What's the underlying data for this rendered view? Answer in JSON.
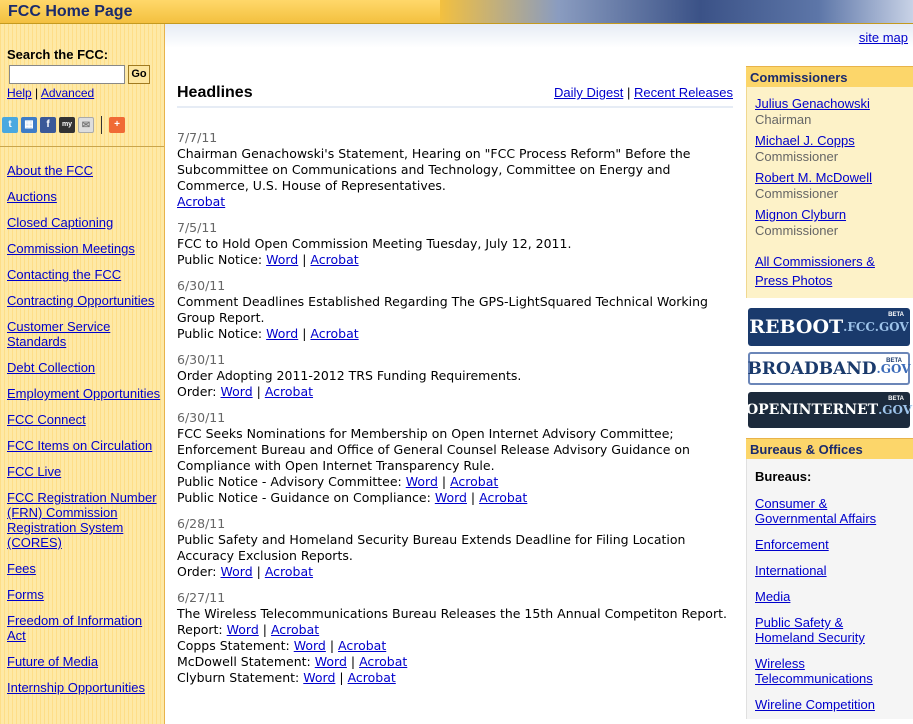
{
  "header": {
    "title": "FCC Home Page",
    "site_map": "site map"
  },
  "search": {
    "label": "Search the FCC:",
    "value": "",
    "go": "Go",
    "help": "Help",
    "advanced": "Advanced"
  },
  "share_icons": [
    "twitter-icon",
    "delicious-icon",
    "facebook-icon",
    "myspace-icon",
    "email-icon",
    "addthis-plus-icon"
  ],
  "left_nav": [
    "About the FCC",
    "Auctions",
    "Closed Captioning",
    "Commission Meetings",
    "Contacting the FCC",
    "Contracting Opportunities",
    "Customer Service Standards",
    "Debt Collection",
    "Employment Opportunities",
    "FCC Connect",
    "FCC Items on Circulation",
    "FCC Live",
    "FCC Registration Number (FRN) Commission Registration System (CORES)",
    "Fees",
    "Forms",
    "Freedom of Information Act",
    "Future of Media",
    "Internship Opportunities"
  ],
  "headlines": {
    "title": "Headlines",
    "daily_digest": "Daily Digest",
    "recent_releases": "Recent Releases",
    "items": [
      {
        "date": "7/7/11",
        "text": "Chairman Genachowski's Statement, Hearing on \"FCC Process Reform\" Before the Subcommittee on Communications and Technology, Committee on Energy and Commerce, U.S. House of Representatives.",
        "links": [
          {
            "label": "",
            "docs": [
              "Acrobat"
            ]
          }
        ]
      },
      {
        "date": "7/5/11",
        "text": "FCC to Hold Open Commission Meeting Tuesday, July 12, 2011.",
        "links": [
          {
            "label": "Public Notice:",
            "docs": [
              "Word",
              "Acrobat"
            ]
          }
        ]
      },
      {
        "date": "6/30/11",
        "text": "Comment Deadlines Established Regarding The GPS-LightSquared Technical Working Group Report.",
        "links": [
          {
            "label": "Public Notice:",
            "docs": [
              "Word",
              "Acrobat"
            ]
          }
        ]
      },
      {
        "date": "6/30/11",
        "text": "Order Adopting 2011-2012 TRS Funding Requirements.",
        "links": [
          {
            "label": "Order:",
            "docs": [
              "Word",
              "Acrobat"
            ]
          }
        ]
      },
      {
        "date": "6/30/11",
        "text": "FCC Seeks Nominations for Membership on Open Internet Advisory Committee; Enforcement Bureau and Office of General Counsel Release Advisory Guidance on Compliance with Open Internet Transparency Rule.",
        "links": [
          {
            "label": "Public Notice - Advisory Committee:",
            "docs": [
              "Word",
              "Acrobat"
            ]
          },
          {
            "label": "Public Notice - Guidance on Compliance:",
            "docs": [
              "Word",
              "Acrobat"
            ]
          }
        ]
      },
      {
        "date": "6/28/11",
        "text": "Public Safety and Homeland Security Bureau Extends Deadline for Filing Location Accuracy Exclusion Reports.",
        "links": [
          {
            "label": "Order:",
            "docs": [
              "Word",
              "Acrobat"
            ]
          }
        ]
      },
      {
        "date": "6/27/11",
        "text": "The Wireless Telecommunications Bureau Releases the 15th Annual Competiton Report.",
        "links": [
          {
            "label": "Report:",
            "docs": [
              "Word",
              "Acrobat"
            ]
          },
          {
            "label": "Copps Statement:",
            "docs": [
              "Word",
              "Acrobat"
            ]
          },
          {
            "label": "McDowell Statement:",
            "docs": [
              "Word",
              "Acrobat"
            ]
          },
          {
            "label": "Clyburn Statement:",
            "docs": [
              "Word",
              "Acrobat"
            ]
          }
        ]
      }
    ]
  },
  "commissioners": {
    "title": "Commissioners",
    "people": [
      {
        "name": "Julius Genachowski",
        "role": "Chairman"
      },
      {
        "name": "Michael J. Copps",
        "role": "Commissioner"
      },
      {
        "name": "Robert M. McDowell",
        "role": "Commissioner"
      },
      {
        "name": "Mignon Clyburn",
        "role": "Commissioner"
      }
    ],
    "all_link": "All Commissioners & Press Photos"
  },
  "promos": {
    "reboot": {
      "main": "REBOOT",
      "suffix": ".FCC.GOV",
      "beta": "BETA"
    },
    "broadband": {
      "main": "BROADBAND",
      "suffix": ".GOV",
      "beta": "BETA"
    },
    "openinternet": {
      "main": "OPENINTERNET",
      "suffix": ".GOV",
      "beta": "BETA"
    }
  },
  "bureaus": {
    "title": "Bureaus & Offices",
    "label": "Bureaus:",
    "items": [
      "Consumer & Governmental Affairs",
      "Enforcement",
      "International",
      "Media",
      "Public Safety & Homeland Security",
      "Wireless Telecommunications",
      "Wireline Competition"
    ]
  },
  "colors": {
    "accent_gold": "#fcd66a",
    "link": "#0000cc",
    "navy": "#1a2a6c"
  }
}
